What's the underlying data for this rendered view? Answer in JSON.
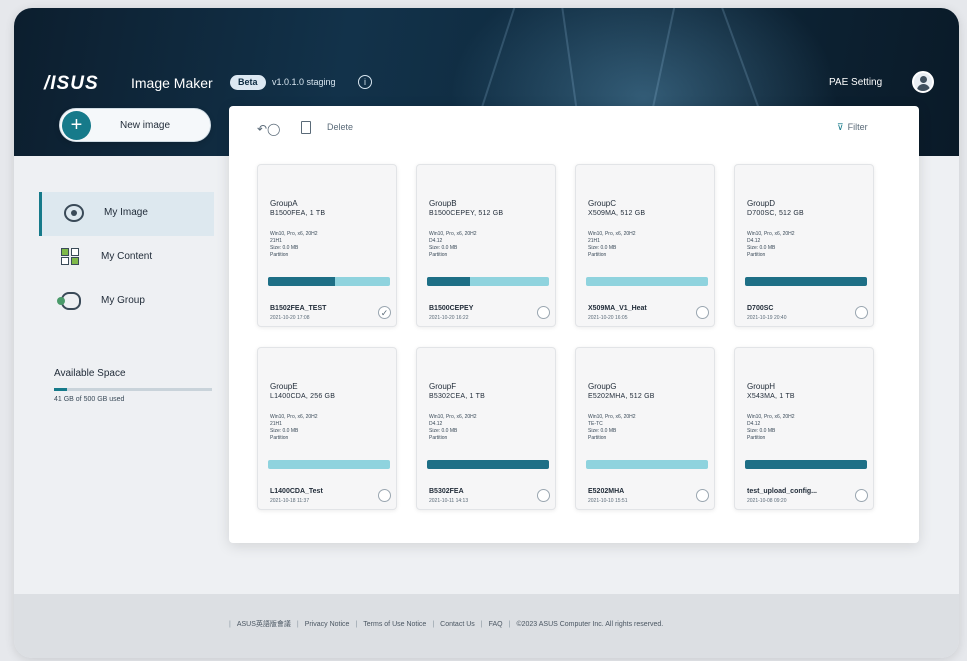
{
  "header": {
    "logo": "/ISUS",
    "app_title": "Image Maker",
    "beta_badge": "Beta",
    "version": "v1.0.1.0 staging",
    "pae_setting": "PAE Setting"
  },
  "new_image": {
    "label": "New image",
    "plus": "+"
  },
  "sidebar": {
    "items": [
      {
        "label": "My Image",
        "icon": "eye-icon",
        "active": true
      },
      {
        "label": "My Content",
        "icon": "grid-icon",
        "active": false
      },
      {
        "label": "My Group",
        "icon": "group-icon",
        "active": false
      }
    ],
    "available_space": {
      "title": "Available Space",
      "used_text": "41 GB of 500 GB used",
      "used_fraction": 0.082
    }
  },
  "toolbar": {
    "undo": "↶◯",
    "delete_label": "Delete",
    "filter_label": "Filter",
    "filter_icon": "filter-icon"
  },
  "cards": [
    {
      "group": "GroupA",
      "model": "B1500FEA, 1 TB",
      "spec": [
        "Win10, Pro, x6, 20H2",
        "21H1",
        "Size: 0.0 MB",
        "Partition"
      ],
      "bar": [
        0.55,
        0.1
      ],
      "name": "B1502FEA_TEST",
      "date": "2021-10-20 17:08",
      "checked": true
    },
    {
      "group": "GroupB",
      "model": "B1500CEPEY, 512 GB",
      "spec": [
        "Win10, Pro, x6, 20H2",
        "D4.12",
        "Size: 0.0 MB",
        "Partition"
      ],
      "bar": [
        0.35,
        0.3
      ],
      "name": "B1500CEPEY",
      "date": "2021-10-20 16:22",
      "checked": false
    },
    {
      "group": "GroupC",
      "model": "X509MA, 512 GB",
      "spec": [
        "Win10, Pro, x6, 20H2",
        "21H1",
        "Size: 0.0 MB",
        "Partition"
      ],
      "bar": [
        0.0,
        0.0
      ],
      "name": "X509MA_V1_Heat",
      "date": "2021-10-20 16:05",
      "checked": false
    },
    {
      "group": "GroupD",
      "model": "D700SC, 512 GB",
      "spec": [
        "Win10, Pro, x6, 20H2",
        "D4.12",
        "Size: 0.0 MB",
        "Partition"
      ],
      "bar": [
        1.0,
        0.0
      ],
      "name": "D700SC",
      "date": "2021-10-19 20:40",
      "checked": false
    },
    {
      "group": "GroupE",
      "model": "L1400CDA, 256 GB",
      "spec": [
        "Win10, Pro, x6, 20H2",
        "21H1",
        "Size: 0.0 MB",
        "Partition"
      ],
      "bar": [
        0.0,
        0.0
      ],
      "name": "L1400CDA_Test",
      "date": "2021-10-18 11:37",
      "checked": false
    },
    {
      "group": "GroupF",
      "model": "B5302CEA, 1 TB",
      "spec": [
        "Win10, Pro, x6, 20H2",
        "D4.12",
        "Size: 0.0 MB",
        "Partition"
      ],
      "bar": [
        1.0,
        0.0
      ],
      "name": "B5302FEA",
      "date": "2021-10-11 14:13",
      "checked": false
    },
    {
      "group": "GroupG",
      "model": "E5202MHA, 512 GB",
      "spec": [
        "Win10, Pro, x6, 20H2",
        "TE-TC",
        "Size: 0.0 MB",
        "Partition"
      ],
      "bar": [
        0.0,
        0.0
      ],
      "name": "E5202MHA",
      "date": "2021-10-10 15:51",
      "checked": false
    },
    {
      "group": "GroupH",
      "model": "X543MA, 1 TB",
      "spec": [
        "Win10, Pro, x6, 20H2",
        "D4.12",
        "Size: 0.0 MB",
        "Partition"
      ],
      "bar": [
        1.0,
        0.0
      ],
      "name": "test_upload_config...",
      "date": "2021-10-08 09:20",
      "checked": false
    }
  ],
  "footer": {
    "links": [
      "ASUS英語版會議",
      "Privacy Notice",
      "Terms of Use Notice",
      "Contact Us",
      "FAQ",
      "©2023 ASUS Computer Inc. All rights reserved."
    ]
  },
  "colors": {
    "accent": "#167a8a",
    "bar_dark": "#1e6f86",
    "bar_light": "#8fd3de",
    "hero": "#12324a"
  }
}
